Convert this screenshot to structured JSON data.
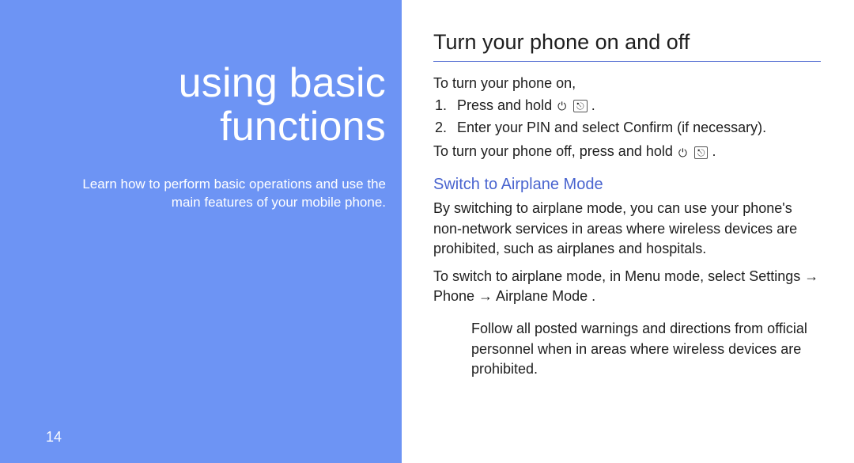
{
  "left": {
    "chapter_title_line1": "using basic",
    "chapter_title_line2": "functions",
    "blurb": "Learn how to perform basic operations and use the main features of your mobile phone.",
    "page_number": "14"
  },
  "right": {
    "heading": "Turn your phone on and off",
    "turn_on_intro": "To turn your phone on,",
    "step1_num": "1.",
    "step1_text_a": "Press and hold ",
    "step2_num": "2.",
    "step2_text_a": "Enter your PIN and select ",
    "step2_confirm": "Confirm",
    "step2_text_b": " (if necessary).",
    "turn_off_a": "To turn your phone off, press and hold ",
    "period": ".",
    "airplane_heading": "Switch to Airplane Mode",
    "airplane_para": "By switching to airplane mode, you can use your phone's non-network services in areas where wireless devices are prohibited, such as airplanes and hospitals.",
    "switch_para_a": "To switch to airplane mode, in Menu mode, select ",
    "switch_para_path": "Settings → Phone → Airplane Mode",
    "note": "Follow all posted warnings and directions from official personnel when in areas where wireless devices are prohibited."
  }
}
